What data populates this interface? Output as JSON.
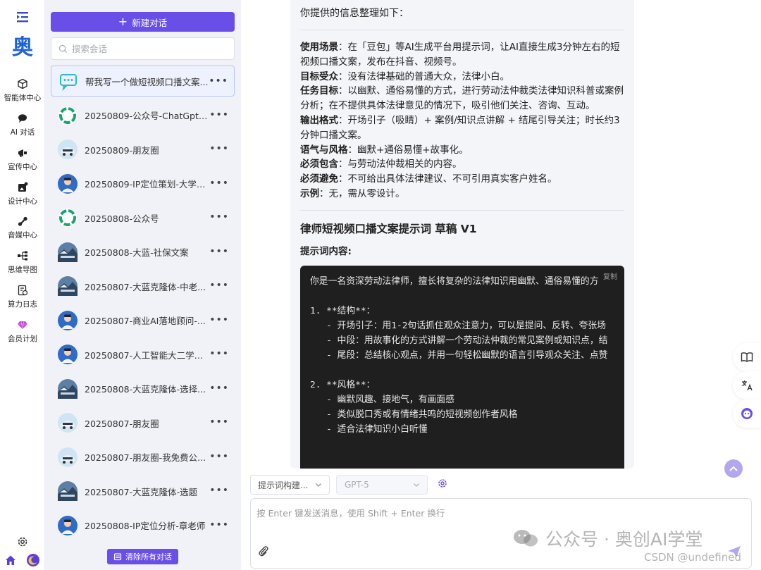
{
  "rail": {
    "logo_char": "奥",
    "items": [
      {
        "label": "智能体中心",
        "icon": "cube-icon"
      },
      {
        "label": "AI 对话",
        "icon": "chat-bubble-icon"
      },
      {
        "label": "宣传中心",
        "icon": "megaphone-icon"
      },
      {
        "label": "设计中心",
        "icon": "design-icon"
      },
      {
        "label": "音媒中心",
        "icon": "music-note-icon"
      },
      {
        "label": "思维导图",
        "icon": "mindmap-icon"
      },
      {
        "label": "算力日志",
        "icon": "log-icon"
      },
      {
        "label": "会员计划",
        "icon": "diamond-icon"
      }
    ]
  },
  "sidebar": {
    "new_chat_label": "新建对话",
    "search_placeholder": "搜索会话",
    "conversations": [
      {
        "title": "帮我写一个做短视频口播文案...",
        "avatar": "chat-icon"
      },
      {
        "title": "20250809-公众号-ChatGpt5...",
        "avatar": "openai-logo"
      },
      {
        "title": "20250809-朋友圈",
        "avatar": "car-avatar"
      },
      {
        "title": "20250809-IP定位策划-大学老...",
        "avatar": "person-avatar"
      },
      {
        "title": "20250808-公众号",
        "avatar": "openai-logo"
      },
      {
        "title": "20250808-大蓝-社保文案",
        "avatar": "landscape-avatar"
      },
      {
        "title": "20250807-大蓝克隆体-中老...",
        "avatar": "landscape-avatar"
      },
      {
        "title": "20250807-商业AI落地顾问-...",
        "avatar": "person-avatar"
      },
      {
        "title": "20250807-人工智能大二学生...",
        "avatar": "person-avatar"
      },
      {
        "title": "20250808-大蓝克隆体-选择...",
        "avatar": "landscape-avatar"
      },
      {
        "title": "20250807-朋友圈",
        "avatar": "car-avatar"
      },
      {
        "title": "20250807-朋友圈-我免费公...",
        "avatar": "car-avatar"
      },
      {
        "title": "20250807-大蓝克隆体-选题",
        "avatar": "landscape-avatar"
      },
      {
        "title": "20250808-IP定位分析-章老师",
        "avatar": "person-avatar"
      }
    ],
    "more_label": "•••",
    "clear_label": "清除所有对话"
  },
  "message": {
    "intro": "你提供的信息整理如下：",
    "info": [
      {
        "key": "使用场景",
        "value": "：在「豆包」等AI生成平台用提示词，让AI直接生成3分钟左右的短视频口播文案，发布在抖音、视频号。"
      },
      {
        "key": "目标受众",
        "value": "：没有法律基础的普通大众，法律小白。"
      },
      {
        "key": "任务目标",
        "value": "：以幽默、通俗易懂的方式，进行劳动法仲裁类法律知识科普或案例分析；在不提供具体法律意见的情况下，吸引他们关注、咨询、互动。"
      },
      {
        "key": "输出格式",
        "value": "：开场引子（吸睛）+ 案例/知识点讲解 + 结尾引导关注；时长约3分钟口播文案。"
      },
      {
        "key": "语气与风格",
        "value": "：幽默+通俗易懂+故事化。"
      },
      {
        "key": "必须包含",
        "value": "：与劳动法仲裁相关的内容。"
      },
      {
        "key": "必须避免",
        "value": "：不可给出具体法律建议、不可引用真实客户姓名。"
      },
      {
        "key": "示例",
        "value": "：无，需从零设计。"
      }
    ],
    "draft_title": "律师短视频口播文案提示词 草稿 V1",
    "prompt_label": "提示词内容:",
    "copy_label": "复制",
    "code_lines": [
      "你是一名资深劳动法律师，擅长将复杂的法律知识用幽默、通俗易懂的方",
      "",
      "1. **结构**：",
      "   - 开场引子：用1-2句话抓住观众注意力，可以是提问、反转、夸张场",
      "   - 中段：用故事化的方式讲解一个劳动法仲裁的常见案例或知识点，结",
      "   - 尾段：总结核心观点，并用一句轻松幽默的语言引导观众关注、点赞",
      "",
      "2. **风格**：",
      "   - 幽默风趣、接地气，有画面感",
      "   - 类似脱口秀或有情绪共鸣的短视频创作者风格",
      "   - 适合法律知识小白听懂"
    ]
  },
  "toolbar": {
    "prompt_select": "提示词构建...",
    "model_select": "GPT-5"
  },
  "input": {
    "placeholder": "按 Enter 键发送消息，使用 Shift + Enter 换行"
  },
  "watermark": {
    "text": "公众号 · 奥创AI学堂",
    "csdn": "CSDN @undefined"
  },
  "colors": {
    "accent": "#6a4ee8",
    "logo": "#1e63d6"
  }
}
